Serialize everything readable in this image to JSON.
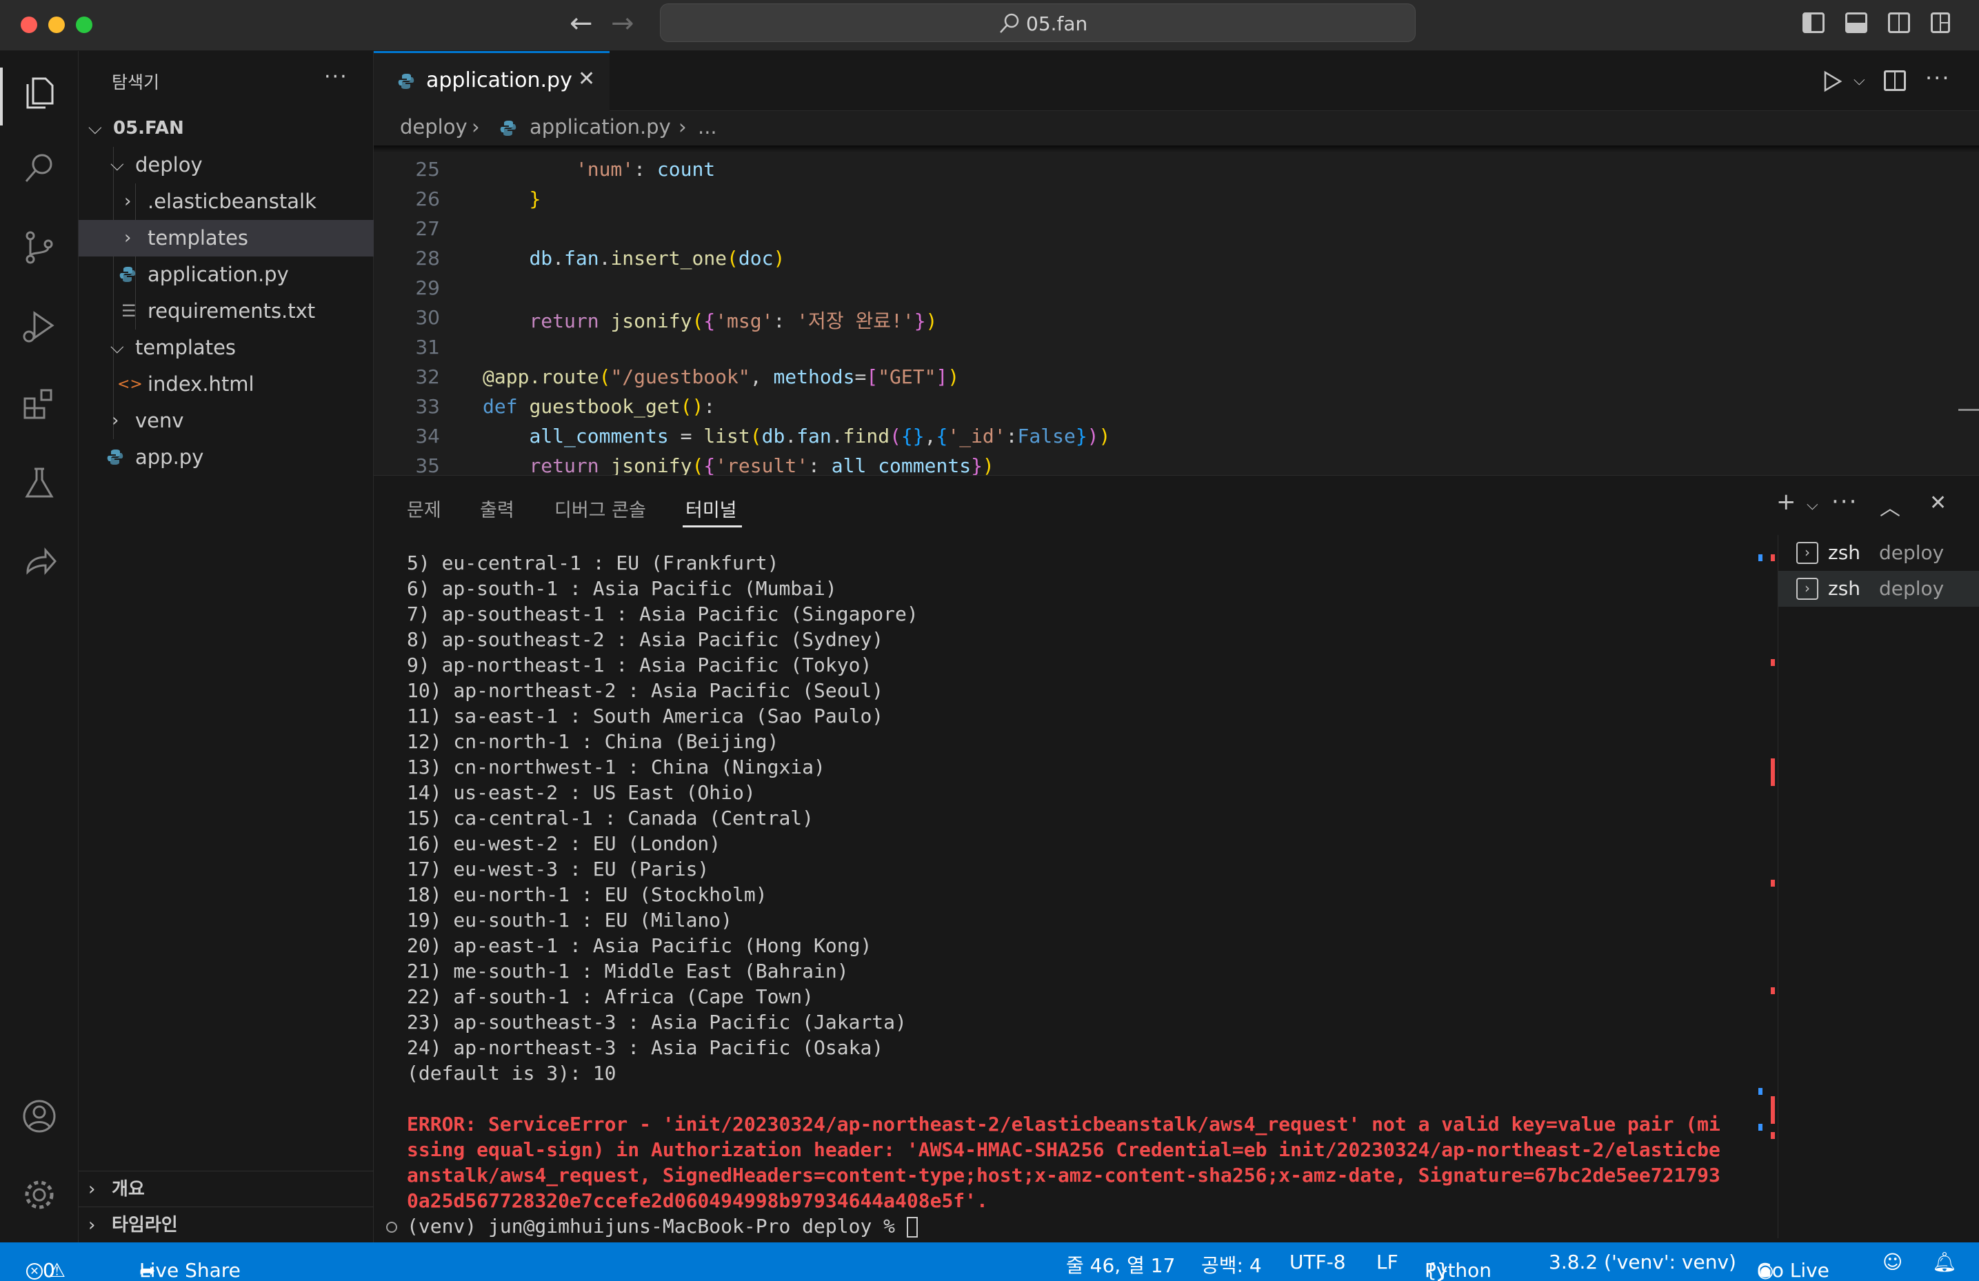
{
  "titlebar": {
    "search_text": "05.fan"
  },
  "sidebar": {
    "header": "탐색기",
    "more": "···",
    "root": "05.FAN",
    "items": [
      {
        "label": "deploy",
        "type": "folder-open",
        "depth": 1
      },
      {
        "label": ".elasticbeanstalk",
        "type": "folder",
        "depth": 2
      },
      {
        "label": "templates",
        "type": "folder",
        "depth": 2
      },
      {
        "label": "application.py",
        "type": "python",
        "depth": 2
      },
      {
        "label": "requirements.txt",
        "type": "text",
        "depth": 2
      },
      {
        "label": "templates",
        "type": "folder-open",
        "depth": 1
      },
      {
        "label": "index.html",
        "type": "html",
        "depth": 2
      },
      {
        "label": "venv",
        "type": "folder",
        "depth": 1
      },
      {
        "label": "app.py",
        "type": "python",
        "depth": 1
      }
    ],
    "outline": "개요",
    "timeline": "타임라인"
  },
  "editor": {
    "tab_label": "application.py",
    "breadcrumb": [
      "deploy",
      "application.py",
      "..."
    ],
    "line_numbers": [
      "25",
      "26",
      "27",
      "28",
      "29",
      "30",
      "31",
      "32",
      "33",
      "34",
      "35"
    ]
  },
  "panel": {
    "tabs": [
      "문제",
      "출력",
      "디버그 콘솔",
      "터미널"
    ],
    "terminal_lines": [
      "5) eu-central-1 : EU (Frankfurt)",
      "6) ap-south-1 : Asia Pacific (Mumbai)",
      "7) ap-southeast-1 : Asia Pacific (Singapore)",
      "8) ap-southeast-2 : Asia Pacific (Sydney)",
      "9) ap-northeast-1 : Asia Pacific (Tokyo)",
      "10) ap-northeast-2 : Asia Pacific (Seoul)",
      "11) sa-east-1 : South America (Sao Paulo)",
      "12) cn-north-1 : China (Beijing)",
      "13) cn-northwest-1 : China (Ningxia)",
      "14) us-east-2 : US East (Ohio)",
      "15) ca-central-1 : Canada (Central)",
      "16) eu-west-2 : EU (London)",
      "17) eu-west-3 : EU (Paris)",
      "18) eu-north-1 : EU (Stockholm)",
      "19) eu-south-1 : EU (Milano)",
      "20) ap-east-1 : Asia Pacific (Hong Kong)",
      "21) me-south-1 : Middle East (Bahrain)",
      "22) af-south-1 : Africa (Cape Town)",
      "23) ap-southeast-3 : Asia Pacific (Jakarta)",
      "24) ap-northeast-3 : Asia Pacific (Osaka)",
      "(default is 3): 10"
    ],
    "error_lines": [
      "ERROR: ServiceError - 'init/20230324/ap-northeast-2/elasticbeanstalk/aws4_request' not a valid key=value pair (mi",
      "ssing equal-sign) in Authorization header: 'AWS4-HMAC-SHA256 Credential=eb init/20230324/ap-northeast-2/elasticbe",
      "anstalk/aws4_request, SignedHeaders=content-type;host;x-amz-content-sha256;x-amz-date, Signature=67bc2de5ee721793",
      "0a25d567728320e7ccefe2d060494998b97934644a408e5f'."
    ],
    "prompt": "(venv) jun@gimhuijuns-MacBook-Pro deploy % ",
    "terminals": [
      {
        "name": "zsh",
        "dir": "deploy"
      },
      {
        "name": "zsh",
        "dir": "deploy"
      }
    ]
  },
  "statusbar": {
    "errors": "0",
    "warnings": "0",
    "live_share": "Live Share",
    "position": "줄 46, 열 17",
    "spaces": "공백: 4",
    "encoding": "UTF-8",
    "eol": "LF",
    "language": "Python",
    "interpreter": "3.8.2 ('venv': venv)",
    "go_live": "Go Live"
  },
  "colors": {
    "accent": "#0078d4",
    "error": "#f14c4c",
    "bg": "#1e1e1e",
    "sidebar_bg": "#181818"
  }
}
